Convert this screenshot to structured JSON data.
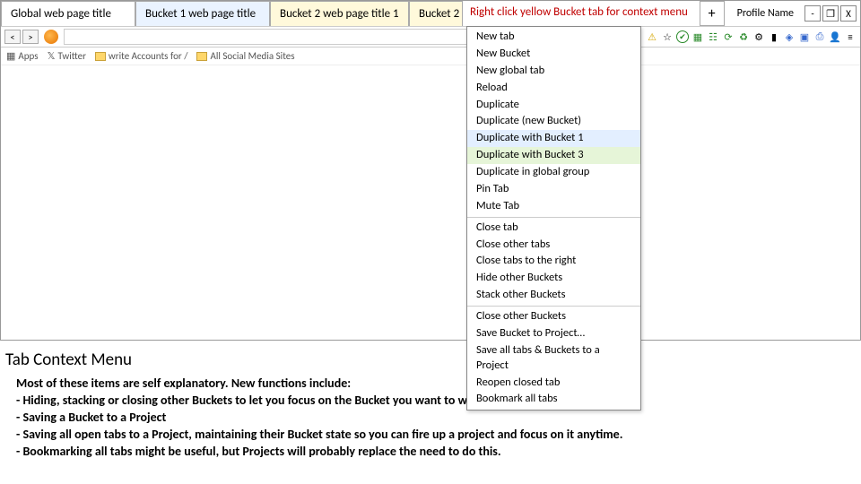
{
  "tabs": {
    "global": "Global web page title",
    "b1": "Bucket 1 web page title",
    "b2a": "Bucket 2 web page title 1",
    "b2b": "Bucket 2"
  },
  "hint": "Right click yellow Bucket tab for context menu",
  "newtab": "+",
  "profile": "Profile Name",
  "win": {
    "min": "-",
    "max": "❐",
    "close": "X"
  },
  "nav": {
    "back": "<",
    "fwd": ">"
  },
  "ticons": {
    "warn": "⚠",
    "star": "☆",
    "check": "✔",
    "pw": "▦",
    "cal": "☷",
    "sync": "⟳",
    "recycle": "♻",
    "gear": "⚙",
    "bar": "▮",
    "sq": "◈",
    "book": "▣",
    "print": "⎙",
    "user": "👤",
    "menu": "≡"
  },
  "bookmarks": {
    "apps": "Apps",
    "apps_ic": "▦",
    "twitter": "Twitter",
    "twitter_ic": "𝕏",
    "accounts": "write Accounts for /",
    "social": "All Social Media Sites"
  },
  "menu": {
    "m0": "New tab",
    "m1": "New Bucket",
    "m2": "New global tab",
    "m3": "Reload",
    "m4": "Duplicate",
    "m5": "Duplicate (new Bucket)",
    "m6": "Duplicate with Bucket 1",
    "m7": "Duplicate with Bucket 3",
    "m8": "Duplicate in global group",
    "m9": "Pin Tab",
    "m10": "Mute Tab",
    "m11": "Close tab",
    "m12": "Close other tabs",
    "m13": "Close tabs to the right",
    "m14": "Hide other Buckets",
    "m15": "Stack other Buckets",
    "m16": "Close other Buckets",
    "m17": "Save Bucket to Project…",
    "m18": "Save all tabs & Buckets to a Project",
    "m19": "Reopen closed tab",
    "m20": "Bookmark all tabs"
  },
  "doc": {
    "heading": "Tab Context Menu",
    "l1": "Most of these items are self explanatory. New functions include:",
    "l2": "- Hiding, stacking or closing other Buckets to let you focus on the Bucket you want to work in.",
    "l3": "- Saving a Bucket to a Project",
    "l4": "- Saving all open tabs to a Project, maintaining their Bucket state so you can fire up a project and focus on it anytime.",
    "l5": "- Bookmarking all tabs might be useful, but Projects will probably replace the need to do this."
  }
}
